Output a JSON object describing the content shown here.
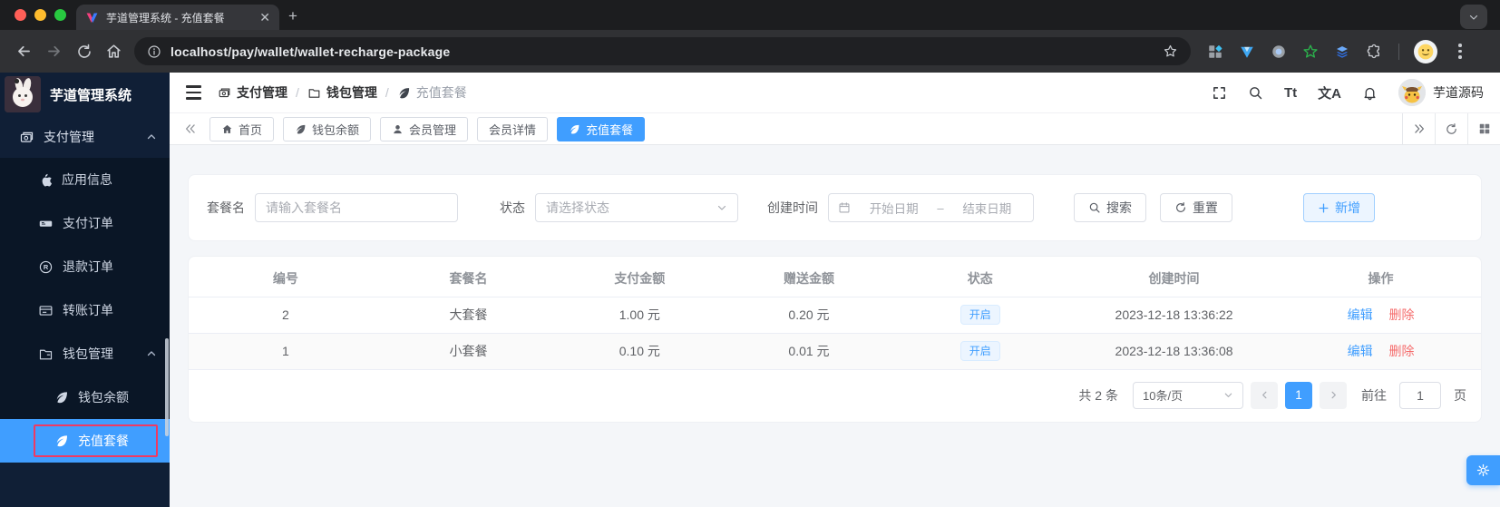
{
  "browser": {
    "tab_title": "芋道管理系统 - 充值套餐",
    "url": "localhost/pay/wallet/wallet-recharge-package"
  },
  "sidebar": {
    "app_title": "芋道管理系统",
    "items": [
      {
        "label": "支付管理"
      },
      {
        "label": "应用信息"
      },
      {
        "label": "支付订单"
      },
      {
        "label": "退款订单"
      },
      {
        "label": "转账订单"
      },
      {
        "label": "钱包管理"
      },
      {
        "label": "钱包余额"
      },
      {
        "label": "充值套餐"
      }
    ]
  },
  "header": {
    "breadcrumb": [
      {
        "label": "支付管理"
      },
      {
        "label": "钱包管理"
      },
      {
        "label": "充值套餐"
      }
    ],
    "font_size_icon_text": "Tt",
    "language_icon_text": "文A",
    "username": "芋道源码"
  },
  "tabbar": {
    "tabs": [
      {
        "label": "首页"
      },
      {
        "label": "钱包余额"
      },
      {
        "label": "会员管理"
      },
      {
        "label": "会员详情"
      },
      {
        "label": "充值套餐"
      }
    ]
  },
  "filter": {
    "name_label": "套餐名",
    "name_placeholder": "请输入套餐名",
    "status_label": "状态",
    "status_placeholder": "请选择状态",
    "date_label": "创建时间",
    "date_start_placeholder": "开始日期",
    "date_separator": "–",
    "date_end_placeholder": "结束日期",
    "search_button": "搜索",
    "reset_button": "重置",
    "add_button": "新增"
  },
  "table": {
    "headers": [
      "编号",
      "套餐名",
      "支付金额",
      "赠送金额",
      "状态",
      "创建时间",
      "操作"
    ],
    "rows": [
      {
        "id": "2",
        "name": "大套餐",
        "pay": "1.00 元",
        "bonus": "0.20 元",
        "status": "开启",
        "created": "2023-12-18 13:36:22",
        "edit": "编辑",
        "delete": "删除"
      },
      {
        "id": "1",
        "name": "小套餐",
        "pay": "0.10 元",
        "bonus": "0.01 元",
        "status": "开启",
        "created": "2023-12-18 13:36:08",
        "edit": "编辑",
        "delete": "删除"
      }
    ]
  },
  "pagination": {
    "total": "共 2 条",
    "page_size": "10条/页",
    "current_page": "1",
    "goto_label": "前往",
    "goto_value": "1",
    "page_unit": "页"
  },
  "colors": {
    "primary": "#409eff",
    "danger": "#f56c6c",
    "sidebar_bg": "#101f36",
    "submenu_bg": "#0a1626",
    "active_menu": "#409eff",
    "focus_ring": "#ef3a63",
    "status_tag_bg": "#ecf5ff"
  }
}
